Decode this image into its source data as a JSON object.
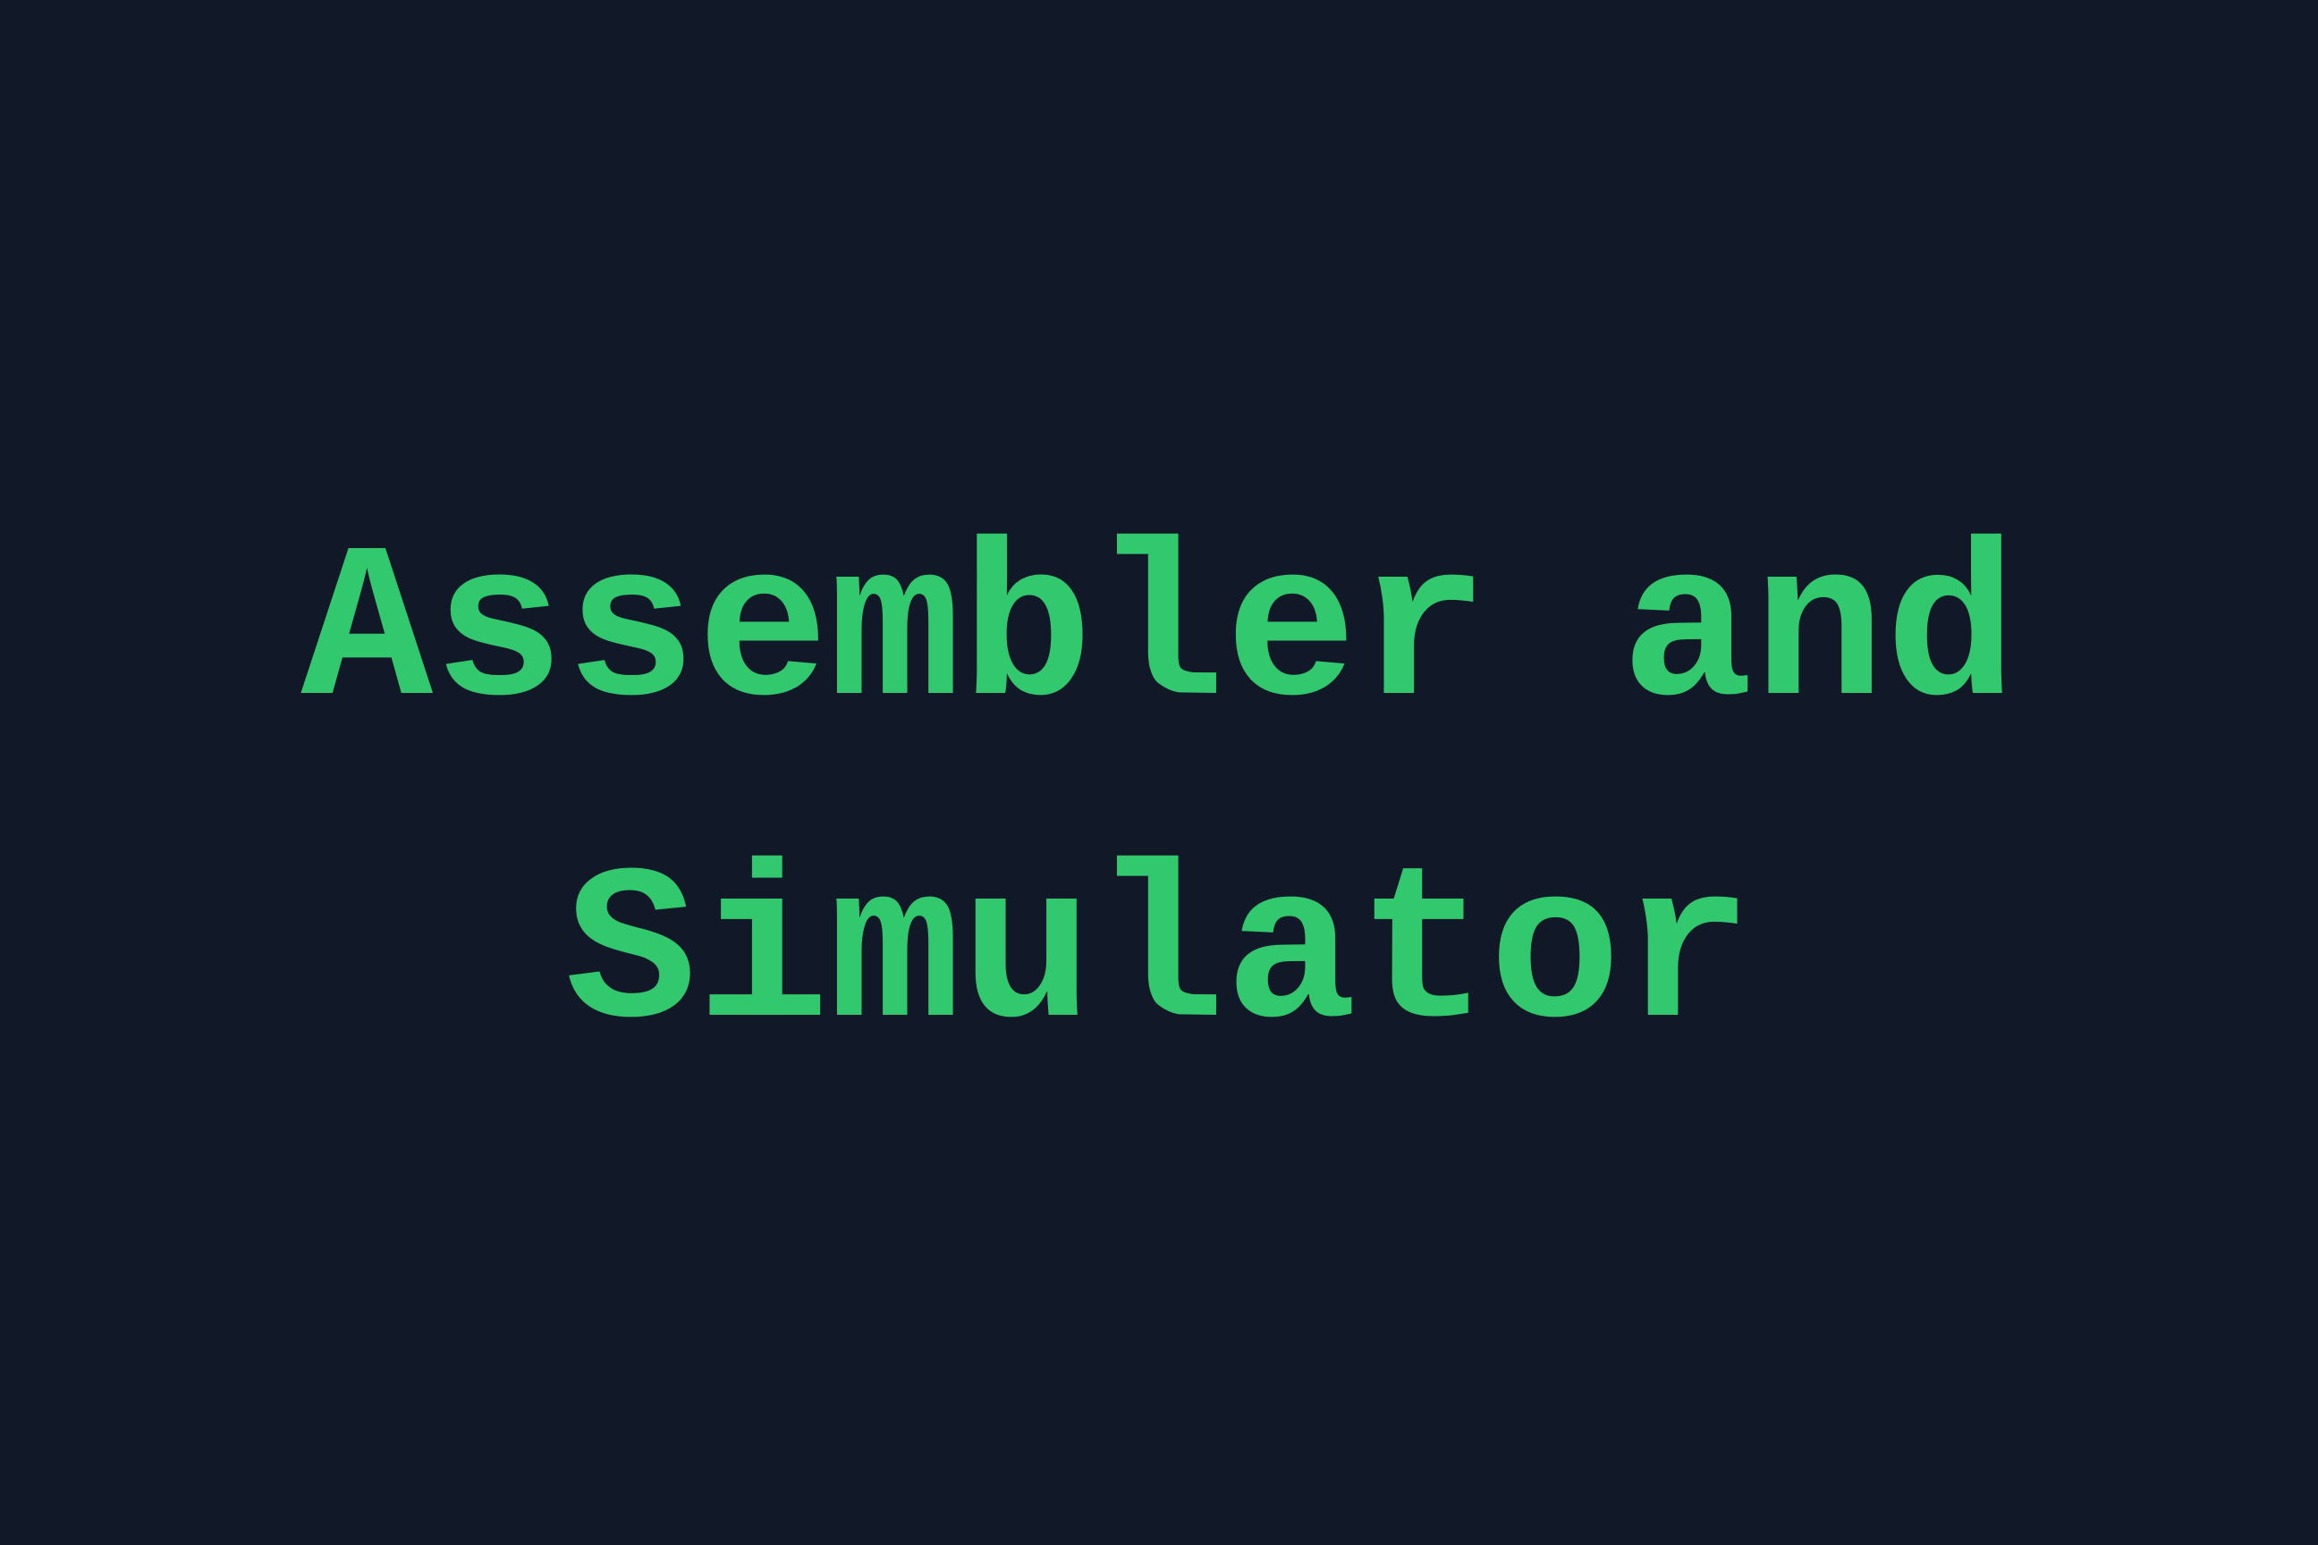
{
  "title": {
    "line1": "Assembler and",
    "line2": "Simulator"
  },
  "colors": {
    "background": "#111827",
    "text": "#32c86e"
  }
}
